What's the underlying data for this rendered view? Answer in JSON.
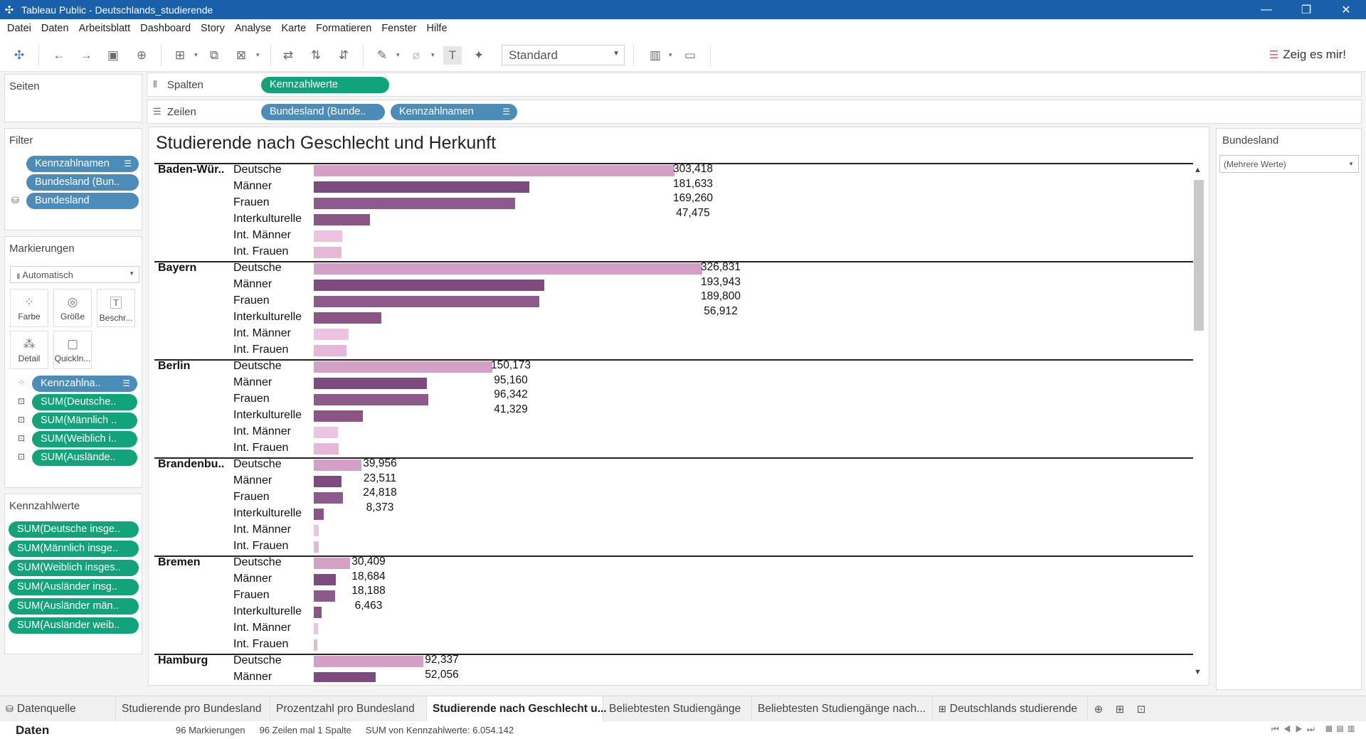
{
  "window": {
    "title": "Tableau Public - Deutschlands_studierende"
  },
  "menu": [
    "Datei",
    "Daten",
    "Arbeitsblatt",
    "Dashboard",
    "Story",
    "Analyse",
    "Karte",
    "Formatieren",
    "Fenster",
    "Hilfe"
  ],
  "toolbar": {
    "fit_select": "Standard",
    "show_me": "Zeig es mir!"
  },
  "pages_panel": {
    "title": "Seiten"
  },
  "shelves": {
    "columns_label": "Spalten",
    "columns_pills": [
      "Kennzahlwerte"
    ],
    "rows_label": "Zeilen",
    "rows_pills": [
      "Bundesland (Bunde..",
      "Kennzahlnamen"
    ]
  },
  "filters": {
    "title": "Filter",
    "pills": [
      "Kennzahlnamen",
      "Bundesland (Bun..",
      "Bundesland"
    ]
  },
  "marks": {
    "title": "Markierungen",
    "type": "Automatisch",
    "buttons": [
      "Farbe",
      "Größe",
      "Beschr...",
      "Detail",
      "QuickIn..."
    ],
    "pills": [
      "Kennzahlna..",
      "SUM(Deutsche..",
      "SUM(Männlich ..",
      "SUM(Weiblich i..",
      "SUM(Auslände.."
    ]
  },
  "measure_values": {
    "title": "Kennzahlwerte",
    "pills": [
      "SUM(Deutsche insge..",
      "SUM(Männlich insge..",
      "SUM(Weiblich insges..",
      "SUM(Ausländer insg..",
      "SUM(Ausländer män..",
      "SUM(Ausländer weib.."
    ]
  },
  "filter_card": {
    "title": "Bundesland",
    "value": "(Mehrere Werte)"
  },
  "chart_data": {
    "type": "bar",
    "title": "Studierende nach Geschlecht und Herkunft",
    "orientation": "horizontal",
    "categories": [
      "Deutsche",
      "Männer",
      "Frauen",
      "Interkulturelle",
      "Int. Männer",
      "Int. Frauen"
    ],
    "colors": [
      "#d4a0c6",
      "#7d4b7d",
      "#8e5a8c",
      "#8a5585",
      "#ecc3e0",
      "#e6b7d8"
    ],
    "xlim": [
      0,
      340000
    ],
    "groups": [
      {
        "name": "Baden-Wür..",
        "values": [
          303418,
          181633,
          169260,
          47475,
          23900,
          23575
        ],
        "labels": [
          "303,418",
          "181,633",
          "169,260",
          "47,475"
        ]
      },
      {
        "name": "Bayern",
        "values": [
          326831,
          193943,
          189800,
          56912,
          29300,
          27612
        ],
        "labels": [
          "326,831",
          "193,943",
          "189,800",
          "56,912"
        ]
      },
      {
        "name": "Berlin",
        "values": [
          150173,
          95160,
          96342,
          41329,
          20400,
          20929
        ],
        "labels": [
          "150,173",
          "95,160",
          "96,342",
          "41,329"
        ]
      },
      {
        "name": "Brandenbu..",
        "values": [
          39956,
          23511,
          24818,
          8373,
          4100,
          4273
        ],
        "labels": [
          "39,956",
          "23,511",
          "24,818",
          "8,373"
        ]
      },
      {
        "name": "Bremen",
        "values": [
          30409,
          18684,
          18188,
          6463,
          3300,
          3163
        ],
        "labels": [
          "30,409",
          "18,684",
          "18,188",
          "6,463"
        ]
      },
      {
        "name": "Hamburg",
        "values": [
          92337,
          52056
        ],
        "labels": [
          "92,337",
          "52,056"
        ]
      }
    ]
  },
  "tabs": {
    "datasource": "Datenquelle",
    "sheets": [
      "Studierende pro Bundesland",
      "Prozentzahl pro Bundesland",
      "Studierende nach Geschlecht u...",
      "Beliebtesten Studiengänge",
      "Beliebtesten Studiengänge nach...",
      "Deutschlands studierende"
    ],
    "active_index": 2
  },
  "status": {
    "pane": "Daten",
    "marks": "96 Markierungen",
    "rows": "96 Zeilen mal 1 Spalte",
    "sum": "SUM von Kennzahlwerte: 6.054.142"
  }
}
